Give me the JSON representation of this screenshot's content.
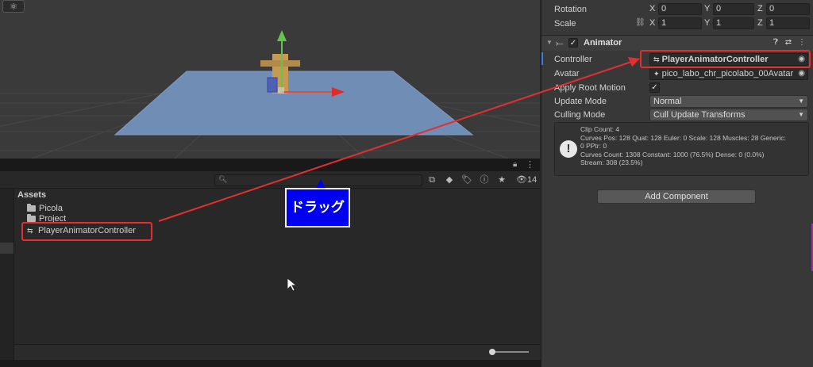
{
  "inspector": {
    "rotation": {
      "label": "Rotation",
      "x": "0",
      "y": "0",
      "z": "0"
    },
    "scale": {
      "label": "Scale",
      "x": "1",
      "y": "1",
      "z": "1"
    },
    "axis_labels": {
      "x": "X",
      "y": "Y",
      "z": "Z"
    },
    "animator": {
      "title": "Animator",
      "controller_label": "Controller",
      "controller_value": "PlayerAnimatorController",
      "avatar_label": "Avatar",
      "avatar_value": "pico_labo_chr_picolabo_00Avatar",
      "apply_root_motion_label": "Apply Root Motion",
      "apply_root_motion_checked": true,
      "update_mode_label": "Update Mode",
      "update_mode_value": "Normal",
      "culling_mode_label": "Culling Mode",
      "culling_mode_value": "Cull Update Transforms",
      "info_lines": [
        "Clip Count: 4",
        "Curves Pos: 128 Quat: 128 Euler: 0 Scale: 128 Muscles: 28 Generic:",
        "0 PPtr: 0",
        "Curves Count: 1308 Constant: 1000 (76.5%) Dense: 0 (0.0%)",
        "Stream: 308 (23.5%)"
      ]
    },
    "add_component": "Add Component"
  },
  "project": {
    "assets_title": "Assets",
    "items": [
      {
        "label": "Picola",
        "icon": "folder-icon"
      },
      {
        "label": "Project",
        "icon": "folder-icon"
      },
      {
        "label": "PlayerAnimatorController",
        "icon": "animator-controller-icon"
      }
    ],
    "visible_count": "14"
  },
  "annotation": {
    "drag_label": "ドラッグ",
    "color": "#e23030",
    "label_bg": "#0000f0"
  }
}
